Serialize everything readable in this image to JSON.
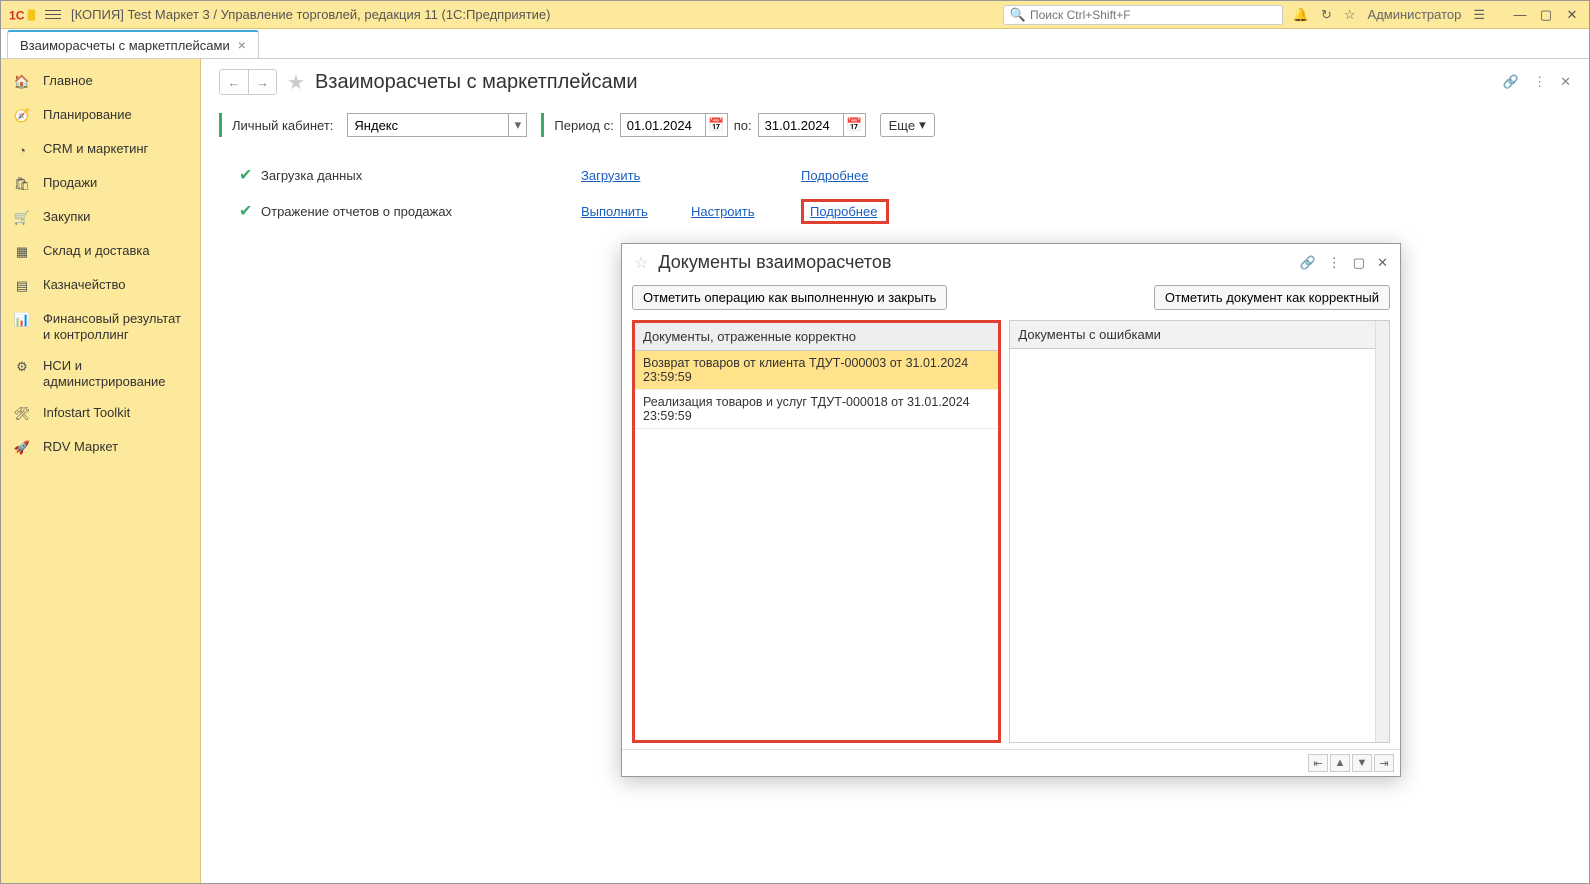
{
  "titlebar": {
    "title": "[КОПИЯ] Test Маркет 3 / Управление торговлей, редакция 11  (1С:Предприятие)",
    "search_placeholder": "Поиск Ctrl+Shift+F",
    "user": "Администратор"
  },
  "tab": {
    "label": "Взаиморасчеты с маркетплейсами"
  },
  "sidebar": {
    "items": [
      "Главное",
      "Планирование",
      "CRM и маркетинг",
      "Продажи",
      "Закупки",
      "Склад и доставка",
      "Казначейство",
      "Финансовый результат и контроллинг",
      "НСИ и администрирование",
      "Infostart Toolkit",
      "RDV Маркет"
    ]
  },
  "page": {
    "title": "Взаиморасчеты с маркетплейсами"
  },
  "filters": {
    "account_label": "Личный кабинет:",
    "account_value": "Яндекс",
    "period_label": "Период с:",
    "date_from": "01.01.2024",
    "to_label": "по:",
    "date_to": "31.01.2024",
    "more": "Еще"
  },
  "steps": {
    "row1": {
      "label": "Загрузка данных",
      "action": "Загрузить",
      "detail": "Подробнее"
    },
    "row2": {
      "label": "Отражение отчетов о продажах",
      "action": "Выполнить",
      "configure": "Настроить",
      "detail": "Подробнее"
    }
  },
  "modal": {
    "title": "Документы взаиморасчетов",
    "btn_complete": "Отметить операцию как выполненную и закрыть",
    "btn_mark": "Отметить документ как корректный",
    "left_header": "Документы, отраженные корректно",
    "right_header": "Документы с ошибками",
    "rows": [
      "Возврат товаров от клиента ТДУТ-000003 от 31.01.2024 23:59:59",
      "Реализация товаров и услуг ТДУТ-000018 от 31.01.2024 23:59:59"
    ]
  }
}
